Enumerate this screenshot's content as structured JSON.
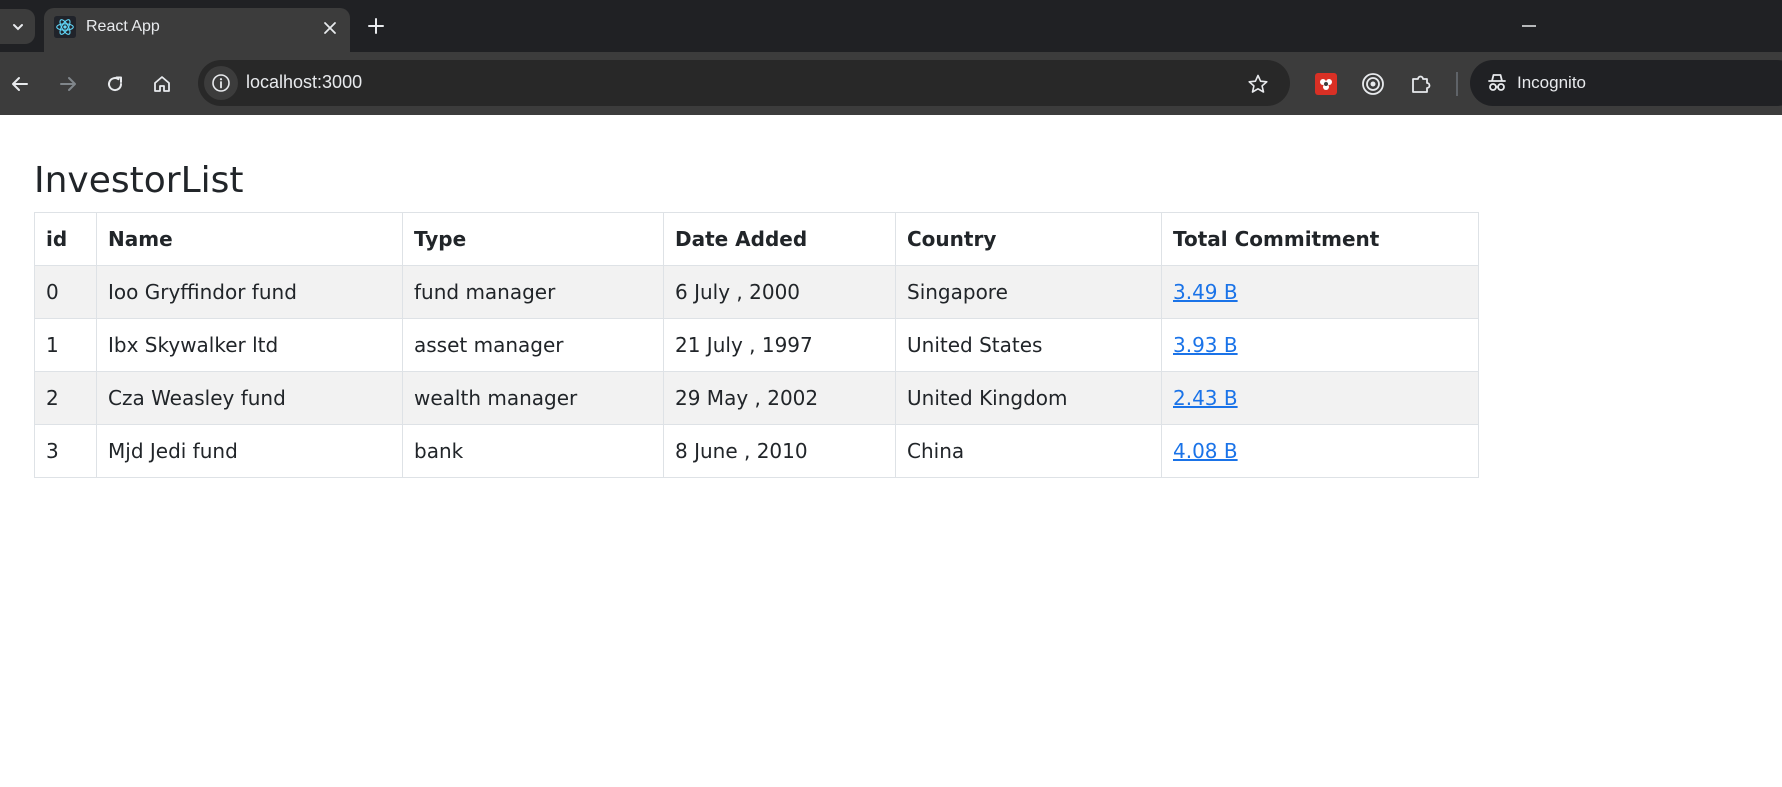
{
  "browser": {
    "tab_title": "React App",
    "url": "localhost:3000",
    "profile_label": "Incognito",
    "icons": {
      "tab_search": "chevron-down-icon",
      "favicon": "react-logo-icon",
      "close": "close-icon",
      "new_tab": "plus-icon",
      "minimize": "minimize-icon",
      "back": "back-arrow-icon",
      "forward": "forward-arrow-icon",
      "reload": "reload-icon",
      "home": "home-icon",
      "site_info": "info-icon",
      "bookmark": "star-icon",
      "extensions": [
        "red-extension-icon",
        "target-extension-icon",
        "puzzle-extensions-icon"
      ],
      "incognito": "incognito-icon"
    },
    "colors": {
      "tabbar_bg": "#202124",
      "toolbar_bg": "#3c3c3c",
      "react_blue": "#61dafb"
    }
  },
  "page": {
    "title": "InvestorList",
    "table": {
      "headers": [
        "id",
        "Name",
        "Type",
        "Date Added",
        "Country",
        "Total Commitment"
      ],
      "rows": [
        [
          "0",
          "Ioo Gryffindor fund",
          "fund manager",
          "6 July , 2000",
          "Singapore",
          "3.49 B"
        ],
        [
          "1",
          "Ibx Skywalker ltd",
          "asset manager",
          "21 July , 1997",
          "United States",
          "3.93 B"
        ],
        [
          "2",
          "Cza Weasley fund",
          "wealth manager",
          "29 May , 2002",
          "United Kingdom",
          "2.43 B"
        ],
        [
          "3",
          "Mjd Jedi fund",
          "bank",
          "8 June , 2010",
          "China",
          "4.08 B"
        ]
      ]
    },
    "colors": {
      "text": "#212529",
      "link": "#1a73e8",
      "striped_row": "#f2f2f2",
      "border": "#dee2e6"
    }
  }
}
